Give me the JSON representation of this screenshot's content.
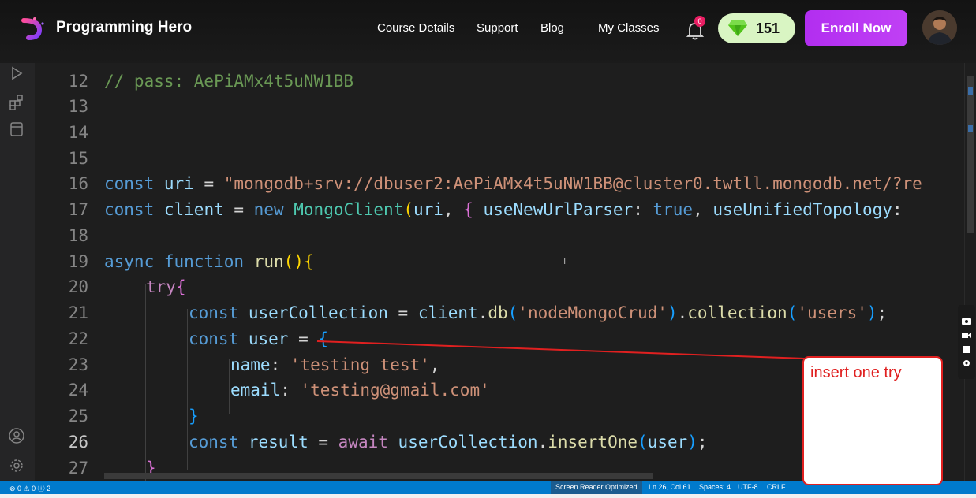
{
  "nav": {
    "brand": "Programming Hero",
    "links": [
      "Course Details",
      "Support",
      "Blog",
      "My Classes"
    ],
    "notification_count": "0",
    "gems": "151",
    "enroll_label": "Enroll Now"
  },
  "editor": {
    "lines": [
      {
        "num": "12"
      },
      {
        "num": "13"
      },
      {
        "num": "14"
      },
      {
        "num": "15"
      },
      {
        "num": "16"
      },
      {
        "num": "17"
      },
      {
        "num": "18"
      },
      {
        "num": "19"
      },
      {
        "num": "20"
      },
      {
        "num": "21"
      },
      {
        "num": "22"
      },
      {
        "num": "23"
      },
      {
        "num": "24"
      },
      {
        "num": "25"
      },
      {
        "num": "26"
      },
      {
        "num": "27"
      }
    ],
    "code": {
      "l12": "// pass: AePiAMx4t5uNW1BB",
      "l16_kw": "const",
      "l16_var": "uri",
      "l16_eq": " = ",
      "l16_str": "\"mongodb+srv://dbuser2:AePiAMx4t5uNW1BB@cluster0.twtll.mongodb.net/?re",
      "l17_kw": "const",
      "l17_var": "client",
      "l17_eq": " = ",
      "l17_new": "new",
      "l17_cls": "MongoClient",
      "l17_p": "(",
      "l17_arg": "uri",
      "l17_comma": ", ",
      "l17_brace": "{",
      "l17_opt1": "useNewUrlParser",
      "l17_colon": ": ",
      "l17_true": "true",
      "l17_comma2": ", ",
      "l17_opt2": "useUnifiedTopology",
      "l17_colon2": ":",
      "l19_kw": "async",
      "l19_fn_kw": "function",
      "l19_fn": "run",
      "l19_p": "()",
      "l19_b": "{",
      "l20_try": "try",
      "l20_b": "{",
      "l21_kw": "const",
      "l21_var": "userCollection",
      "l21_eq": " = ",
      "l21_obj": "client",
      "l21_dot": ".",
      "l21_db": "db",
      "l21_p1": "(",
      "l21_s1": "'nodeMongoCrud'",
      "l21_p2": ")",
      "l21_dot2": ".",
      "l21_coll": "collection",
      "l21_p3": "(",
      "l21_s2": "'users'",
      "l21_p4": ")",
      "l21_semi": ";",
      "l22_kw": "const",
      "l22_var": "user",
      "l22_eq": " = ",
      "l22_b": "{",
      "l23_key": "name",
      "l23_colon": ": ",
      "l23_str": "'testing test'",
      "l23_comma": ",",
      "l24_key": "email",
      "l24_colon": ": ",
      "l24_str": "'testing@gmail.com'",
      "l25_b": "}",
      "l26_kw": "const",
      "l26_var": "result",
      "l26_eq": " = ",
      "l26_await": "await",
      "l26_obj": "userCollection",
      "l26_dot": ".",
      "l26_fn": "insertOne",
      "l26_p1": "(",
      "l26_arg": "user",
      "l26_p2": ")",
      "l26_semi": ";",
      "l27_b": "}"
    }
  },
  "annotation": {
    "text": "insert one try"
  },
  "status": {
    "problems": "⊗ 0 ⚠ 0 ⓘ 2",
    "screen_reader": "Screen Reader Optimized",
    "position": "Ln 26, Col 61",
    "spaces": "Spaces: 4",
    "encoding": "UTF-8",
    "eol": "CRLF"
  },
  "colors": {
    "accent": "#007acc",
    "enroll": "#b22ef0",
    "annotation": "#e02020"
  }
}
